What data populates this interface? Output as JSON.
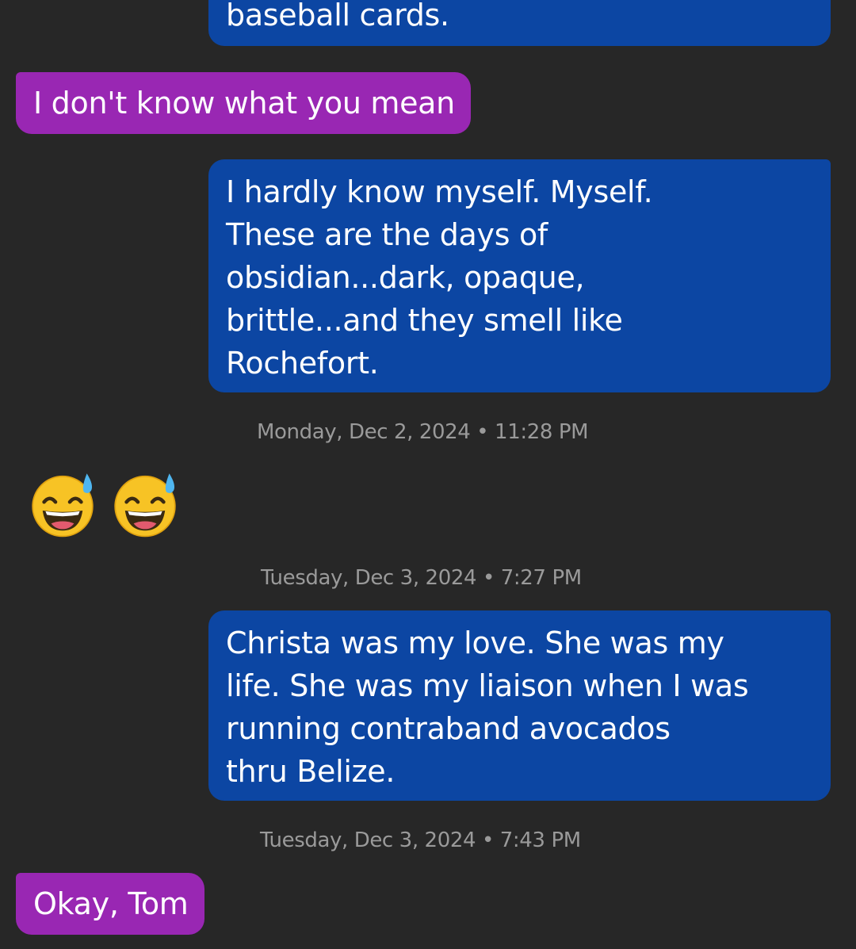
{
  "messages": [
    {
      "lines": [
        "baseball cards."
      ]
    },
    {
      "lines": [
        "I don't know what you mean"
      ]
    },
    {
      "lines": [
        "I hardly know myself.  Myself.",
        "These are the days of",
        "obsidian...dark, opaque,",
        "brittle...and they smell like",
        "Rochefort."
      ]
    },
    {
      "timestamp": "Monday, Dec 2, 2024 • 11:28 PM"
    },
    {
      "emoji": [
        "grinning-face-with-sweat-icon",
        "grinning-face-with-sweat-icon"
      ]
    },
    {
      "timestamp": "Tuesday, Dec 3, 2024 • 7:27 PM"
    },
    {
      "lines": [
        "Christa was my love.  She was my",
        "life.  She was my liaison when I was",
        "running contraband avocados",
        "thru Belize."
      ]
    },
    {
      "timestamp": "Tuesday, Dec 3, 2024 • 7:43 PM"
    },
    {
      "lines": [
        "Okay, Tom"
      ]
    }
  ],
  "colors": {
    "background": "#272727",
    "outgoing_bubble": "#0c46a3",
    "incoming_bubble": "#9927b3",
    "timestamp_text": "#9a9a9a"
  }
}
